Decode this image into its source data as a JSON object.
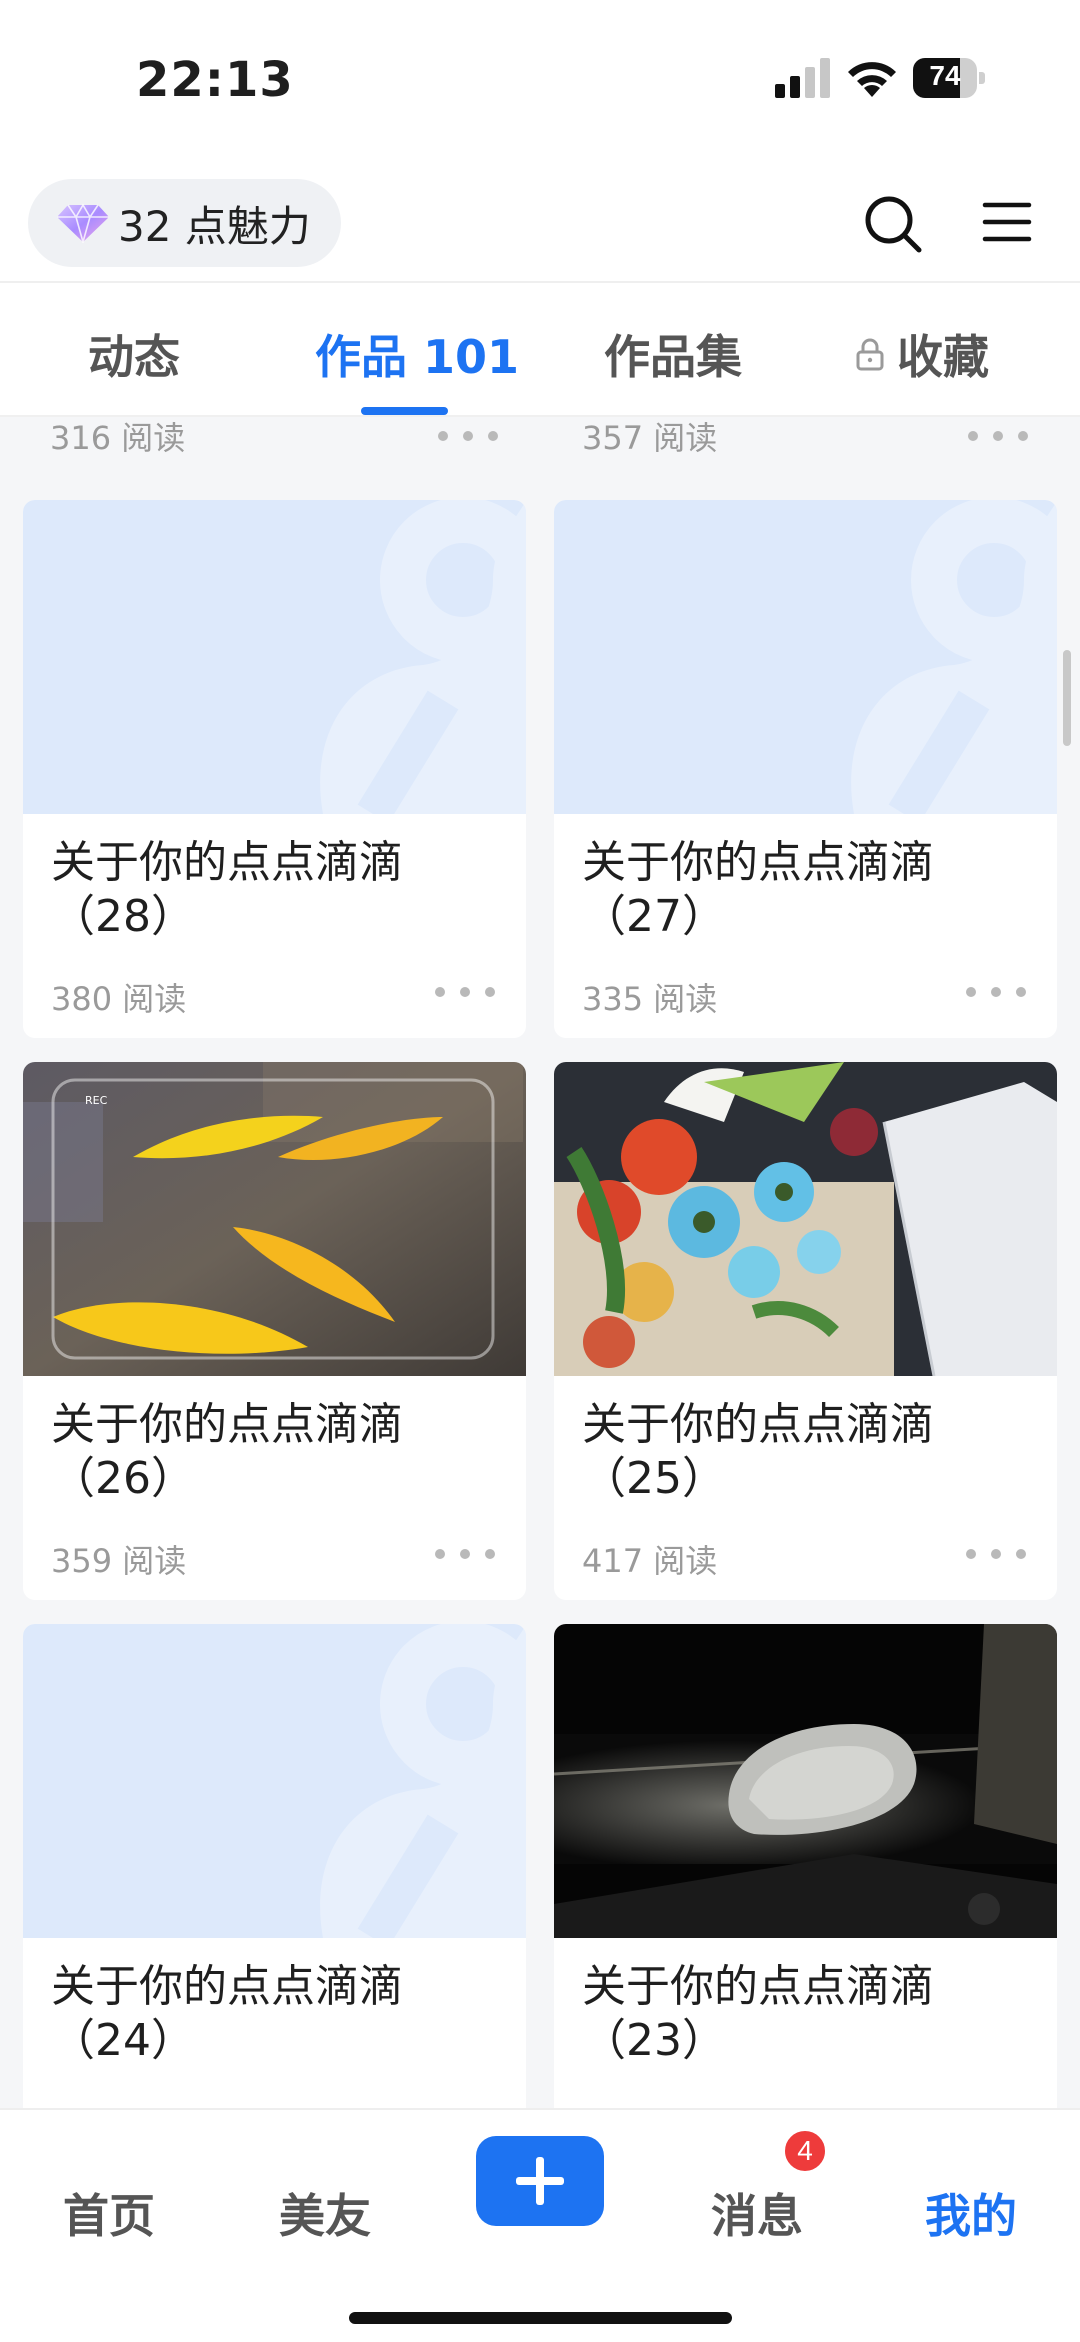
{
  "status_bar": {
    "time": "22:13",
    "battery": "74",
    "battery_fraction": 0.74
  },
  "header": {
    "charm_label": "32 点魅力"
  },
  "tabs": [
    {
      "label": "动态"
    },
    {
      "label": "作品 101"
    },
    {
      "label": "作品集"
    },
    {
      "label": "收藏"
    }
  ],
  "feed": {
    "partial_row": [
      {
        "reads": "316 阅读"
      },
      {
        "reads": "357 阅读"
      }
    ],
    "cards": [
      {
        "title": "关于你的点点滴滴（28）",
        "reads": "380 阅读",
        "thumbnail": "placeholder-logo"
      },
      {
        "title": "关于你的点点滴滴（27）",
        "reads": "335 阅读",
        "thumbnail": "placeholder-logo"
      },
      {
        "title": "关于你的点点滴滴（26）",
        "reads": "359 阅读",
        "thumbnail": "yellow-leaves-photo"
      },
      {
        "title": "关于你的点点滴滴（25）",
        "reads": "417 阅读",
        "thumbnail": "flower-bouquet-photo"
      },
      {
        "title": "关于你的点点滴滴（24）",
        "reads": "",
        "thumbnail": "placeholder-logo"
      },
      {
        "title": "关于你的点点滴滴（23）",
        "reads": "",
        "thumbnail": "car-mirror-night-photo"
      }
    ]
  },
  "bottom_nav": {
    "home": "首页",
    "friends": "美友",
    "messages": "消息",
    "messages_badge": "4",
    "mine": "我的"
  },
  "colors": {
    "accent": "#1d73f2",
    "badge": "#ee3b3b",
    "placeholder_bg": "#dde9fb"
  }
}
